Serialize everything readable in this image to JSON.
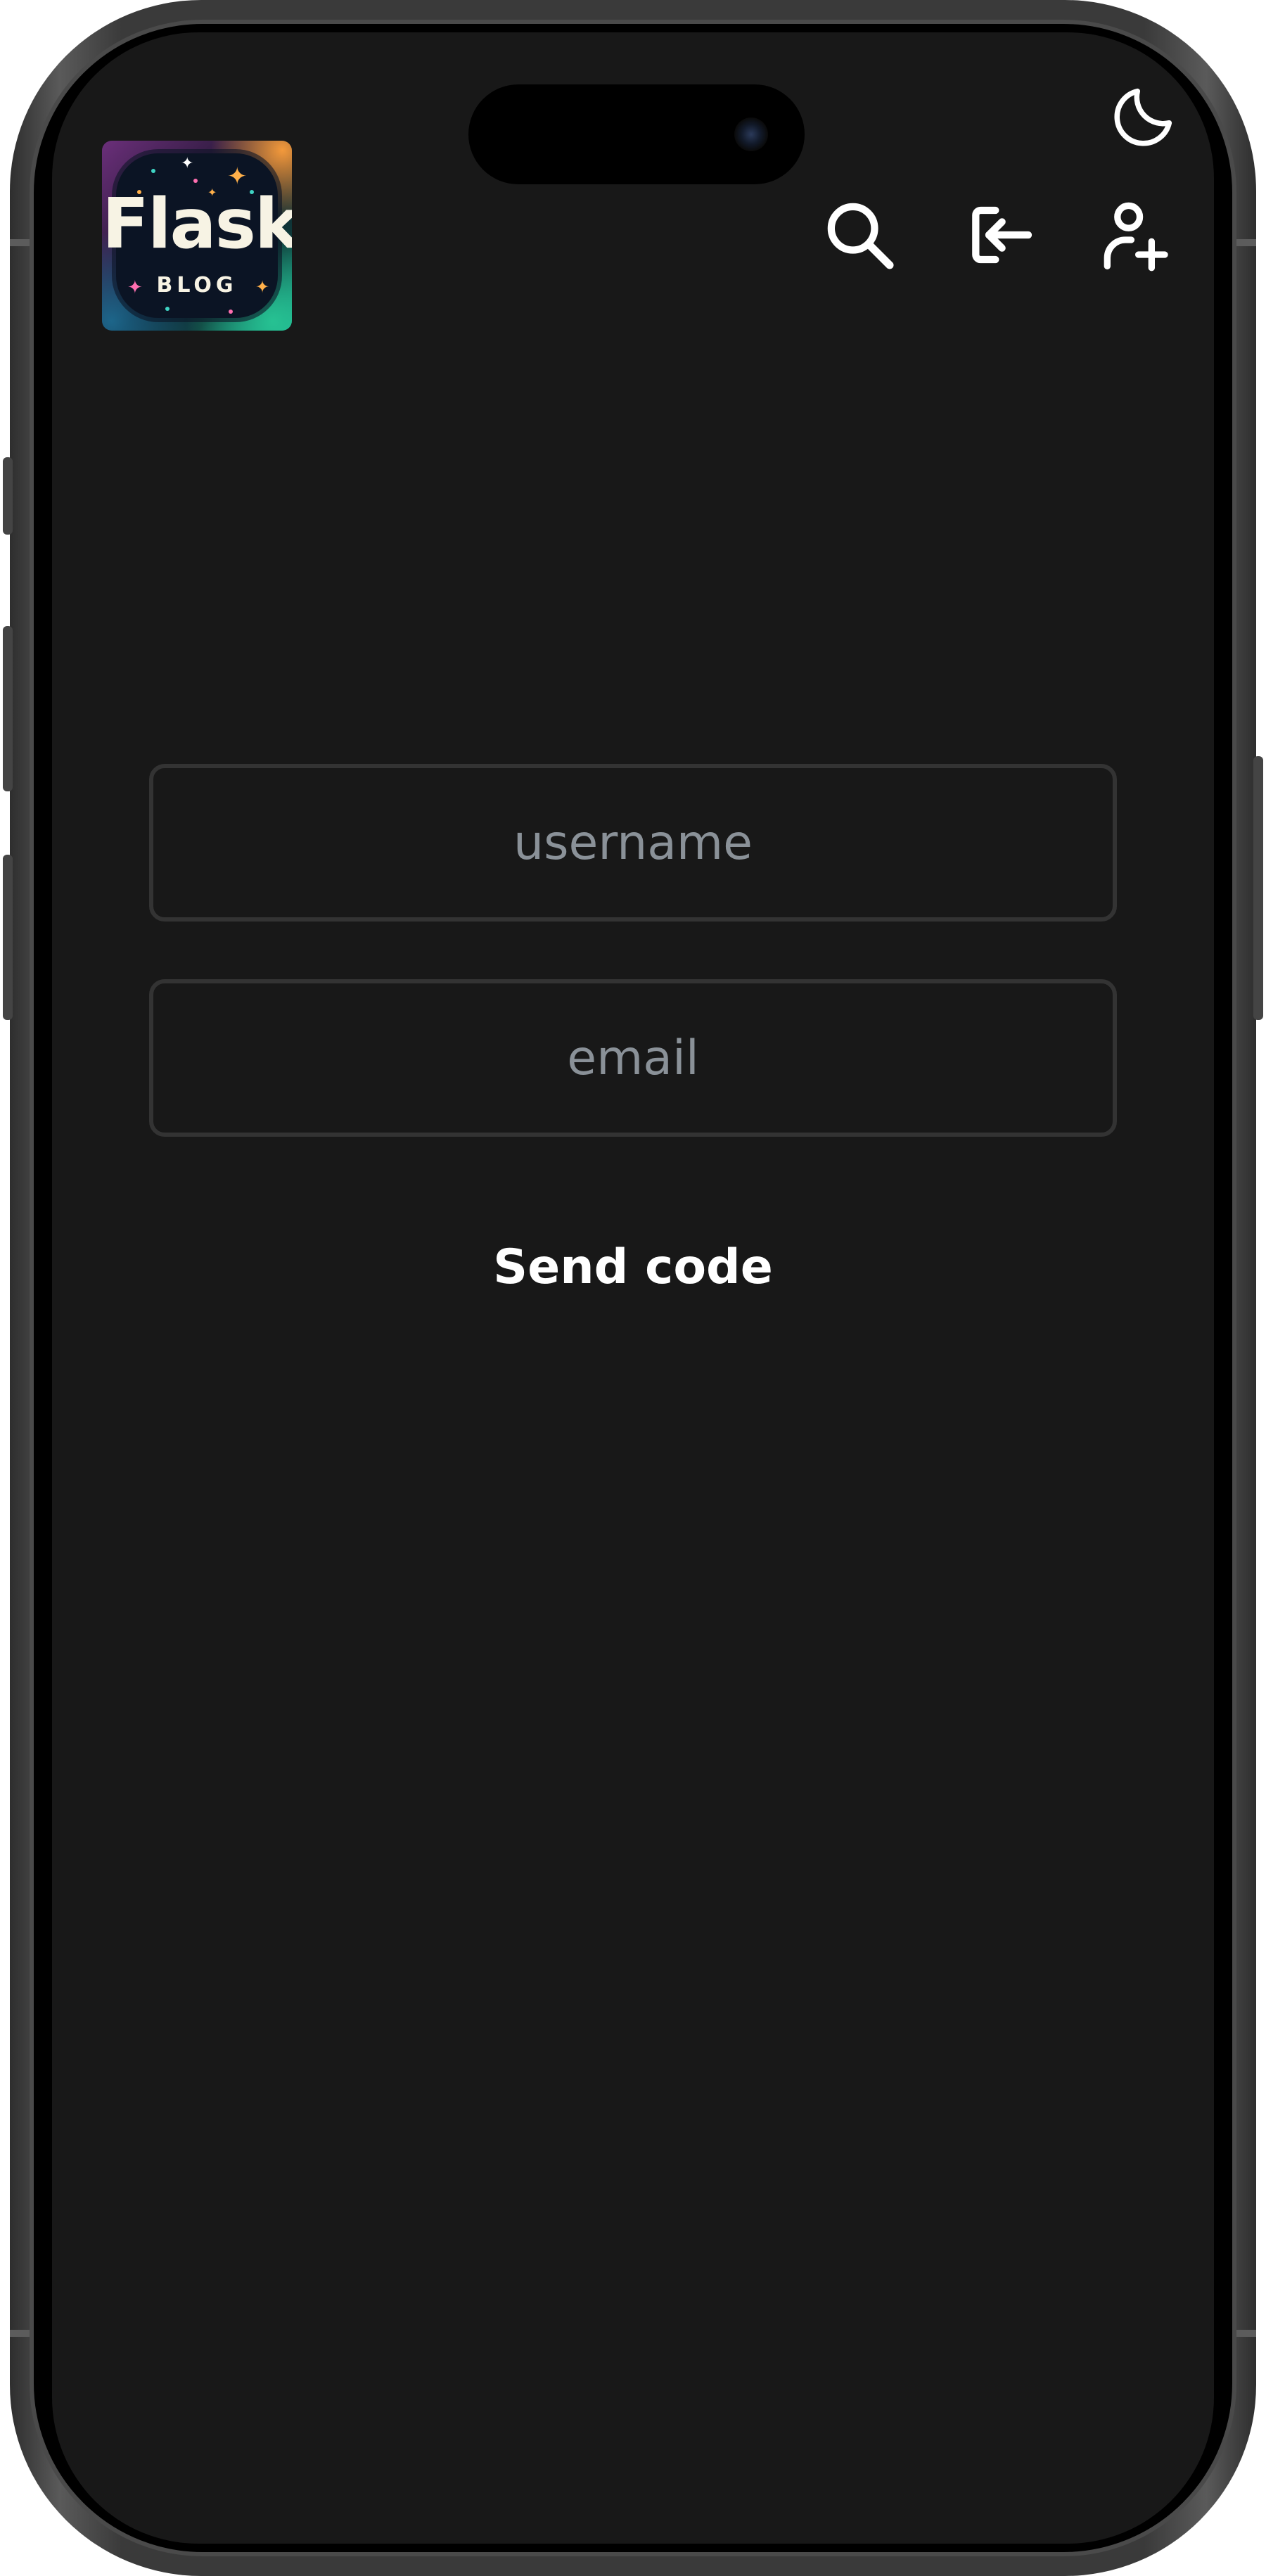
{
  "header": {
    "logo": {
      "title": "Flask",
      "subtitle": "BLOG"
    },
    "icons": {
      "theme_toggle": "moon-icon",
      "search": "search-icon",
      "login": "login-icon",
      "signup": "person-add-icon"
    }
  },
  "form": {
    "username": {
      "placeholder": "username",
      "value": ""
    },
    "email": {
      "placeholder": "email",
      "value": ""
    },
    "submit_label": "Send code"
  },
  "colors": {
    "background": "#181818",
    "field_border": "#333333",
    "placeholder": "#8a9198",
    "text": "#ffffff",
    "icon": "#ffffff"
  }
}
